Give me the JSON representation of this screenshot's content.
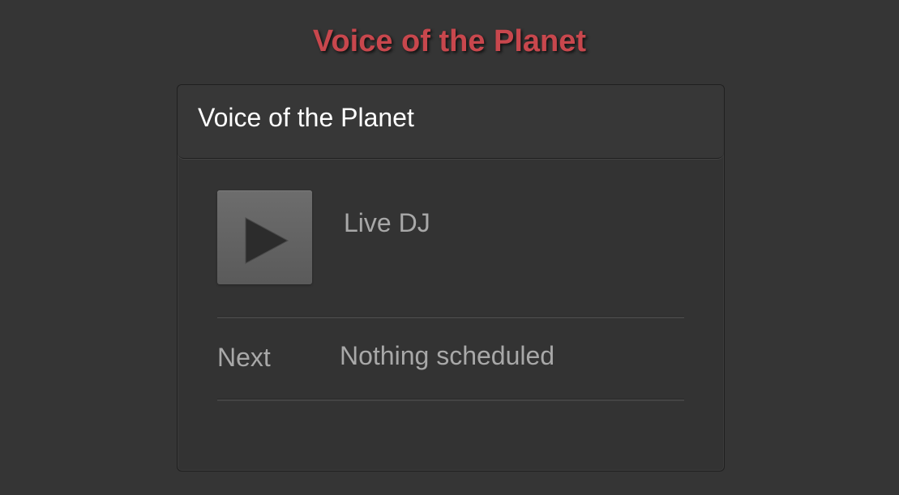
{
  "page": {
    "title": "Voice of the Planet"
  },
  "station": {
    "name": "Voice of the Planet",
    "now_playing": "Live DJ",
    "next_label": "Next",
    "next_value": "Nothing scheduled"
  },
  "icons": {
    "play": "play-icon"
  },
  "colors": {
    "background": "#353535",
    "title_accent": "#c8474d",
    "panel": "#333333",
    "header_text": "#ffffff",
    "muted_text": "#a8a8a8",
    "play_button": "#5f5f5f",
    "play_glyph": "#2c2c2c"
  }
}
